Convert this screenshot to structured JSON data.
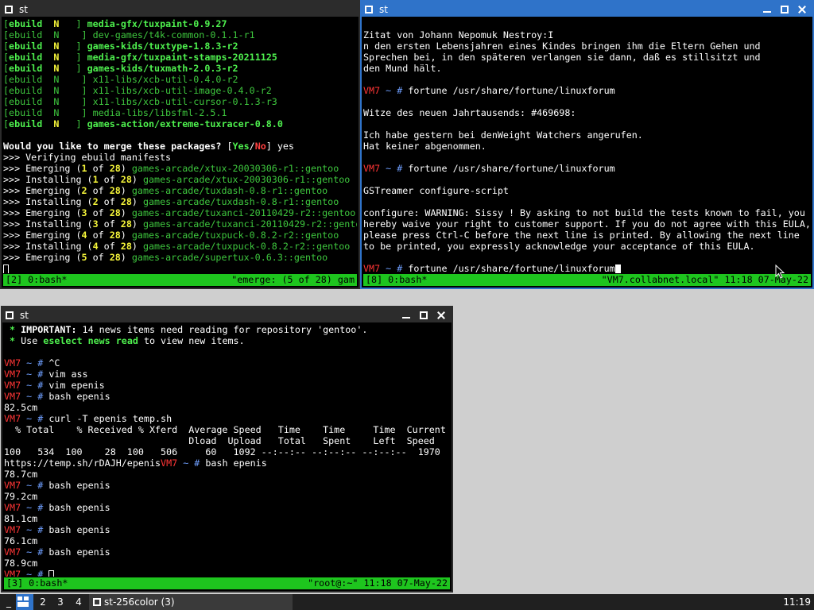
{
  "colors": {
    "active_border": "#2f73c9",
    "status_green": "#1ec51e",
    "prompt_red": "#ff3535",
    "desktop": "#cfcfcf"
  },
  "windows": [
    {
      "id": "win-emerge",
      "title": "st",
      "active": false,
      "lines": [
        [
          [
            "g",
            "["
          ],
          [
            "gb",
            "ebuild"
          ],
          [
            "yb",
            "  N   "
          ],
          [
            "g",
            "] "
          ],
          [
            "gb",
            "media-gfx/tuxpaint-0.9.27"
          ]
        ],
        [
          [
            "g",
            "[ebuild  N    ] dev-games/t4k-common-0.1.1-r1"
          ]
        ],
        [
          [
            "g",
            "["
          ],
          [
            "gb",
            "ebuild"
          ],
          [
            "yb",
            "  N   "
          ],
          [
            "g",
            "] "
          ],
          [
            "gb",
            "games-kids/tuxtype-1.8.3-r2"
          ]
        ],
        [
          [
            "g",
            "["
          ],
          [
            "gb",
            "ebuild"
          ],
          [
            "yb",
            "  N   "
          ],
          [
            "g",
            "] "
          ],
          [
            "gb",
            "media-gfx/tuxpaint-stamps-20211125"
          ]
        ],
        [
          [
            "g",
            "["
          ],
          [
            "gb",
            "ebuild"
          ],
          [
            "yb",
            "  N   "
          ],
          [
            "g",
            "] "
          ],
          [
            "gb",
            "games-kids/tuxmath-2.0.3-r2"
          ]
        ],
        [
          [
            "g",
            "[ebuild  N    ] x11-libs/xcb-util-0.4.0-r2"
          ]
        ],
        [
          [
            "g",
            "[ebuild  N    ] x11-libs/xcb-util-image-0.4.0-r2"
          ]
        ],
        [
          [
            "g",
            "[ebuild  N    ] x11-libs/xcb-util-cursor-0.1.3-r3"
          ]
        ],
        [
          [
            "g",
            "[ebuild  N    ] media-libs/libsfml-2.5.1"
          ]
        ],
        [
          [
            "g",
            "["
          ],
          [
            "gb",
            "ebuild"
          ],
          [
            "yb",
            "  N   "
          ],
          [
            "g",
            "] "
          ],
          [
            "gb",
            "games-action/extreme-tuxracer-0.8.0"
          ]
        ],
        [],
        [
          [
            "wb",
            "Would you like to merge these packages? "
          ],
          [
            "w",
            "["
          ],
          [
            "gb",
            "Yes"
          ],
          [
            "w",
            "/"
          ],
          [
            "rb",
            "No"
          ],
          [
            "w",
            "] yes"
          ]
        ],
        [
          [
            "w",
            ">>> Verifying ebuild manifests"
          ]
        ],
        [
          [
            "w",
            ">>> Emerging ("
          ],
          [
            "yb",
            "1"
          ],
          [
            "w",
            " of "
          ],
          [
            "yb",
            "28"
          ],
          [
            "w",
            ") "
          ],
          [
            "g",
            "games-arcade/xtux-20030306-r1::gentoo"
          ]
        ],
        [
          [
            "w",
            ">>> Installing ("
          ],
          [
            "yb",
            "1"
          ],
          [
            "w",
            " of "
          ],
          [
            "yb",
            "28"
          ],
          [
            "w",
            ") "
          ],
          [
            "g",
            "games-arcade/xtux-20030306-r1::gentoo"
          ]
        ],
        [
          [
            "w",
            ">>> Emerging ("
          ],
          [
            "yb",
            "2"
          ],
          [
            "w",
            " of "
          ],
          [
            "yb",
            "28"
          ],
          [
            "w",
            ") "
          ],
          [
            "g",
            "games-arcade/tuxdash-0.8-r1::gentoo"
          ]
        ],
        [
          [
            "w",
            ">>> Installing ("
          ],
          [
            "yb",
            "2"
          ],
          [
            "w",
            " of "
          ],
          [
            "yb",
            "28"
          ],
          [
            "w",
            ") "
          ],
          [
            "g",
            "games-arcade/tuxdash-0.8-r1::gentoo"
          ]
        ],
        [
          [
            "w",
            ">>> Emerging ("
          ],
          [
            "yb",
            "3"
          ],
          [
            "w",
            " of "
          ],
          [
            "yb",
            "28"
          ],
          [
            "w",
            ") "
          ],
          [
            "g",
            "games-arcade/tuxanci-20110429-r2::gentoo"
          ]
        ],
        [
          [
            "w",
            ">>> Installing ("
          ],
          [
            "yb",
            "3"
          ],
          [
            "w",
            " of "
          ],
          [
            "yb",
            "28"
          ],
          [
            "w",
            ") "
          ],
          [
            "g",
            "games-arcade/tuxanci-20110429-r2::gento"
          ]
        ],
        [
          [
            "w",
            ">>> Emerging ("
          ],
          [
            "yb",
            "4"
          ],
          [
            "w",
            " of "
          ],
          [
            "yb",
            "28"
          ],
          [
            "w",
            ") "
          ],
          [
            "g",
            "games-arcade/tuxpuck-0.8.2-r2::gentoo"
          ]
        ],
        [
          [
            "w",
            ">>> Installing ("
          ],
          [
            "yb",
            "4"
          ],
          [
            "w",
            " of "
          ],
          [
            "yb",
            "28"
          ],
          [
            "w",
            ") "
          ],
          [
            "g",
            "games-arcade/tuxpuck-0.8.2-r2::gentoo"
          ]
        ],
        [
          [
            "w",
            ">>> Emerging ("
          ],
          [
            "yb",
            "5"
          ],
          [
            "w",
            " of "
          ],
          [
            "yb",
            "28"
          ],
          [
            "w",
            ") "
          ],
          [
            "g",
            "games-arcade/supertux-0.6.3::gentoo"
          ]
        ],
        [
          [
            "cursor",
            "hollow"
          ]
        ]
      ],
      "status_left": "[2] 0:bash*",
      "status_right": "\"emerge: (5 of 28) gam"
    },
    {
      "id": "win-fortune",
      "title": "st",
      "active": true,
      "lines": [
        [],
        [
          [
            "w",
            "Zitat von Johann Nepomuk Nestroy:I"
          ]
        ],
        [
          [
            "w",
            "n den ersten Lebensjahren eines Kindes bringen ihm die Eltern Gehen und"
          ]
        ],
        [
          [
            "w",
            "Sprechen bei, in den späteren verlangen sie dann, daß es stillsitzt und"
          ]
        ],
        [
          [
            "w",
            "den Mund hält."
          ]
        ],
        [],
        [
          [
            "r",
            "VM7"
          ],
          [
            "b",
            " ~ # "
          ],
          [
            "w",
            "fortune /usr/share/fortune/linuxforum"
          ]
        ],
        [],
        [
          [
            "w",
            "Witze des neuen Jahrtausends: #469698:"
          ]
        ],
        [],
        [
          [
            "w",
            "Ich habe gestern bei denWeight Watchers angerufen."
          ]
        ],
        [
          [
            "w",
            "Hat keiner abgenommen."
          ]
        ],
        [],
        [
          [
            "r",
            "VM7"
          ],
          [
            "b",
            " ~ # "
          ],
          [
            "w",
            "fortune /usr/share/fortune/linuxforum"
          ]
        ],
        [],
        [
          [
            "w",
            "GSTreamer configure-script"
          ]
        ],
        [],
        [
          [
            "w",
            "configure: WARNING: Sissy ! By asking to not build the tests known to fail, you"
          ]
        ],
        [
          [
            "w",
            "hereby waive your right to customer support. If you do not agree with this EULA,"
          ]
        ],
        [
          [
            "w",
            "please press Ctrl-C before the next line is printed. By allowing the next line"
          ]
        ],
        [
          [
            "w",
            "to be printed, you expressly acknowledge your acceptance of this EULA."
          ]
        ],
        [],
        [
          [
            "r",
            "VM7"
          ],
          [
            "b",
            " ~ # "
          ],
          [
            "w",
            "fortune /usr/share/fortune/linuxforum"
          ],
          [
            "cursor",
            "block"
          ]
        ]
      ],
      "status_left": "[8] 0:bash*",
      "status_right": "\"VM7.collabnet.local\" 11:18 07-May-22"
    },
    {
      "id": "win-curl",
      "title": "st",
      "active": false,
      "lines": [
        [
          [
            "gb",
            " * "
          ],
          [
            "wb",
            "IMPORTANT: "
          ],
          [
            "w",
            "14 news items need reading for repository 'gentoo'."
          ]
        ],
        [
          [
            "gb",
            " * "
          ],
          [
            "w",
            "Use "
          ],
          [
            "gb",
            "eselect news read"
          ],
          [
            "w",
            " to view new items."
          ]
        ],
        [],
        [
          [
            "r",
            "VM7"
          ],
          [
            "b",
            " ~ # "
          ],
          [
            "w",
            "^C"
          ]
        ],
        [
          [
            "r",
            "VM7"
          ],
          [
            "b",
            " ~ # "
          ],
          [
            "w",
            "vim ass"
          ]
        ],
        [
          [
            "r",
            "VM7"
          ],
          [
            "b",
            " ~ # "
          ],
          [
            "w",
            "vim epenis"
          ]
        ],
        [
          [
            "r",
            "VM7"
          ],
          [
            "b",
            " ~ # "
          ],
          [
            "w",
            "bash epenis"
          ]
        ],
        [
          [
            "w",
            "82.5cm"
          ]
        ],
        [
          [
            "r",
            "VM7"
          ],
          [
            "b",
            " ~ # "
          ],
          [
            "w",
            "curl -T epenis temp.sh"
          ]
        ],
        [
          [
            "w",
            "  % Total    % Received % Xferd  Average Speed   Time    Time     Time  Current"
          ]
        ],
        [
          [
            "w",
            "                                 Dload  Upload   Total   Spent    Left  Speed"
          ]
        ],
        [
          [
            "w",
            "100   534  100    28  100   506     60   1092 --:--:-- --:--:-- --:--:--  1970"
          ]
        ],
        [
          [
            "w",
            "https://temp.sh/rDAJH/epenis"
          ],
          [
            "r",
            "VM7"
          ],
          [
            "b",
            " ~ # "
          ],
          [
            "w",
            "bash epenis"
          ]
        ],
        [
          [
            "w",
            "78.7cm"
          ]
        ],
        [
          [
            "r",
            "VM7"
          ],
          [
            "b",
            " ~ # "
          ],
          [
            "w",
            "bash epenis"
          ]
        ],
        [
          [
            "w",
            "79.2cm"
          ]
        ],
        [
          [
            "r",
            "VM7"
          ],
          [
            "b",
            " ~ # "
          ],
          [
            "w",
            "bash epenis"
          ]
        ],
        [
          [
            "w",
            "81.1cm"
          ]
        ],
        [
          [
            "r",
            "VM7"
          ],
          [
            "b",
            " ~ # "
          ],
          [
            "w",
            "bash epenis"
          ]
        ],
        [
          [
            "w",
            "76.1cm"
          ]
        ],
        [
          [
            "r",
            "VM7"
          ],
          [
            "b",
            " ~ # "
          ],
          [
            "w",
            "bash epenis"
          ]
        ],
        [
          [
            "w",
            "78.9cm"
          ]
        ],
        [
          [
            "r",
            "VM7"
          ],
          [
            "b",
            " ~ # "
          ],
          [
            "cursor",
            "hollow"
          ]
        ]
      ],
      "status_left": "[3] 0:bash*",
      "status_right": "\"root@:~\" 11:18 07-May-22"
    }
  ],
  "taskbar": {
    "left_marker": "_",
    "workspaces": [
      "2",
      "3",
      "4"
    ],
    "task_label": "st-256color (3)",
    "clock": "11:19"
  }
}
